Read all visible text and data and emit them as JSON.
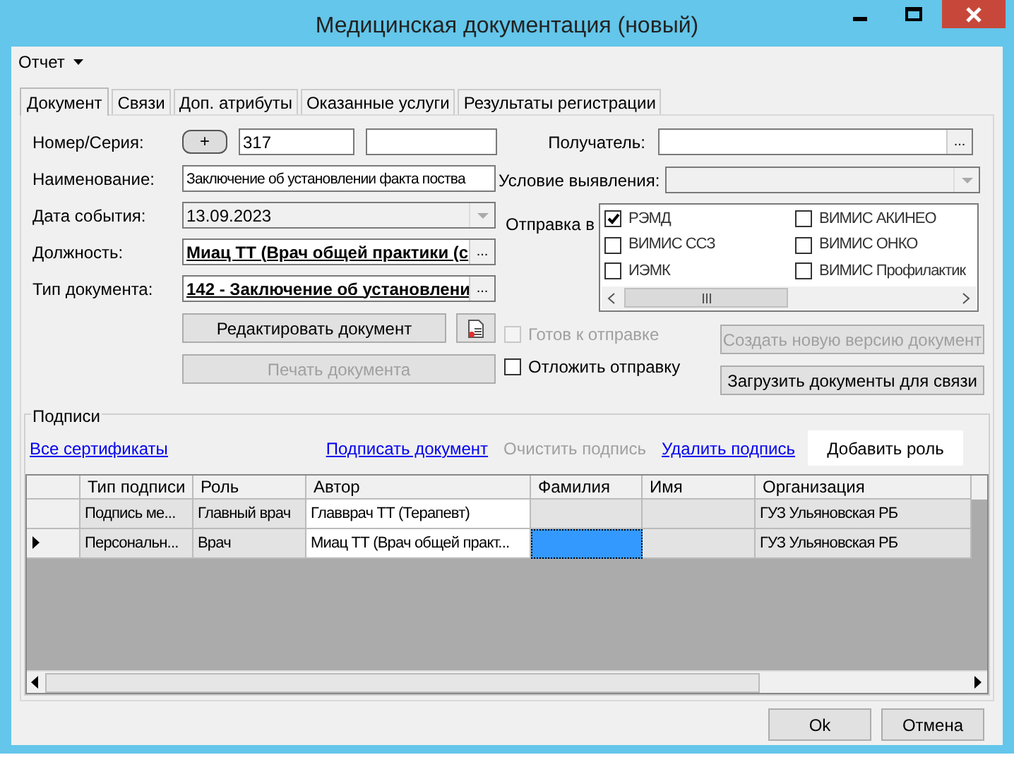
{
  "window": {
    "title": "Медицинская документация (новый)"
  },
  "menu": [
    {
      "label": "Отчет"
    }
  ],
  "tabs": [
    {
      "label": "Документ",
      "selected": true
    },
    {
      "label": "Связи",
      "selected": false
    },
    {
      "label": "Доп. атрибуты",
      "selected": false
    },
    {
      "label": "Оказанные услуги",
      "selected": false
    },
    {
      "label": "Результаты регистрации",
      "selected": false
    }
  ],
  "form": {
    "number": {
      "label": "Номер/Серия:",
      "add_button": "+",
      "value": "317"
    },
    "name": {
      "label": "Наименование:",
      "value": "Заключение об установлении факта поства"
    },
    "event_date": {
      "label": "Дата события:",
      "value": "13.09.2023",
      "disabled": true
    },
    "position": {
      "label": "Должность:",
      "value": "Миац ТТ (Врач общей практики (с",
      "browse": "..."
    },
    "doc_type": {
      "label": "Тип документа:",
      "value": "142 - Заключение об установлени",
      "browse": "..."
    },
    "edit_button": {
      "label": "Редактировать документ",
      "disabled": false
    },
    "print_button": {
      "label": "Печать документа",
      "disabled": true
    },
    "recipient": {
      "label": "Получатель:",
      "browse": "..."
    },
    "condition": {
      "label": "Условие выявления:",
      "disabled": true
    },
    "send_to": {
      "label": "Отправка в",
      "items": [
        {
          "label": "РЭМД",
          "checked": true
        },
        {
          "label": "ВИМИС ССЗ",
          "checked": false
        },
        {
          "label": "ИЭМК",
          "checked": false
        },
        {
          "label": "ВИМИС АКИНЕО",
          "checked": false
        },
        {
          "label": "ВИМИС ОНКО",
          "checked": false
        },
        {
          "label": "ВИМИС Профилактик",
          "checked": false
        }
      ]
    },
    "options": [
      {
        "label": "Готов к отправке",
        "checked": false,
        "disabled": true
      },
      {
        "label": "Отложить отправку",
        "checked": false,
        "disabled": false
      }
    ],
    "actions": [
      {
        "label": "Создать новую версию документ",
        "disabled": true
      },
      {
        "label": "Загрузить документы для связи",
        "disabled": false
      }
    ]
  },
  "signatures": {
    "title": "Подписи",
    "links": [
      {
        "label": "Все сертификаты",
        "disabled": false
      },
      {
        "label": "Подписать документ",
        "disabled": false
      },
      {
        "label": "Очистить подпись",
        "disabled": true
      },
      {
        "label": "Удалить подпись",
        "disabled": false
      }
    ],
    "add_role_button": "Добавить роль",
    "columns": [
      {
        "label": "Тип подписи",
        "kind": "readonly"
      },
      {
        "label": "Роль",
        "kind": "readonly"
      },
      {
        "label": "Автор",
        "kind": "editable"
      },
      {
        "label": "Фамилия",
        "kind": "readonly"
      },
      {
        "label": "Имя",
        "kind": "readonly"
      },
      {
        "label": "Организация",
        "kind": "readonly"
      }
    ],
    "rows": [
      {
        "selected": false,
        "cells": [
          {
            "text": "Подпись ме...",
            "selected": false
          },
          {
            "text": "Главный врач",
            "selected": false
          },
          {
            "text": "Главврач ТТ (Терапевт)",
            "selected": false
          },
          {
            "selected": false
          },
          {
            "selected": false
          },
          {
            "text": "ГУЗ Ульяновская РБ",
            "selected": false
          }
        ]
      },
      {
        "selected": true,
        "cells": [
          {
            "text": "Персональн...",
            "selected": false
          },
          {
            "text": "Врач",
            "selected": false
          },
          {
            "text": "Миац ТТ (Врач общей практ...",
            "selected": false
          },
          {
            "selected": true
          },
          {
            "selected": false
          },
          {
            "text": "ГУЗ Ульяновская РБ",
            "selected": false
          }
        ]
      }
    ]
  },
  "footer": [
    {
      "label": "Ok"
    },
    {
      "label": "Отмена"
    }
  ]
}
